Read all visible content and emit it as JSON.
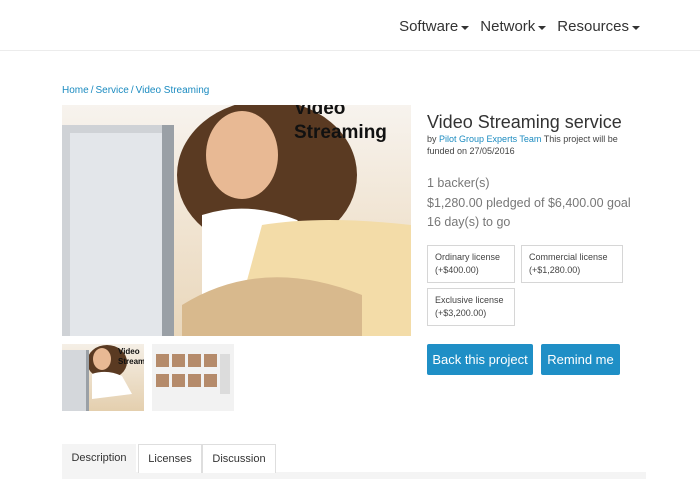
{
  "nav": {
    "items": [
      "Software",
      "Network",
      "Resources"
    ]
  },
  "breadcrumb": {
    "items": [
      "Home",
      "Service",
      "Video Streaming"
    ]
  },
  "project": {
    "image_title": "Video\nStreaming",
    "thumb_title": "Video\nStreami",
    "title": "Video Streaming service",
    "by_prefix": "by",
    "team": "Pilot Group Experts Team",
    "funded_text": "This project will be funded on 27/05/2016",
    "backers": "1 backer(s)",
    "pledged": "$1,280.00 pledged of $6,400.00 goal",
    "days": "16 day(s) to go"
  },
  "licenses": [
    {
      "name": "Ordinary license",
      "price": "(+$400.00)"
    },
    {
      "name": "Commercial license",
      "price": "(+$1,280.00)"
    },
    {
      "name": "Exclusive license",
      "price": "(+$3,200.00)"
    }
  ],
  "buttons": {
    "back": "Back this project",
    "remind": "Remind me"
  },
  "tabs": [
    "Description",
    "Licenses",
    "Discussion"
  ],
  "colors": {
    "accent": "#1f8fc6",
    "link": "#1b8bc0"
  }
}
